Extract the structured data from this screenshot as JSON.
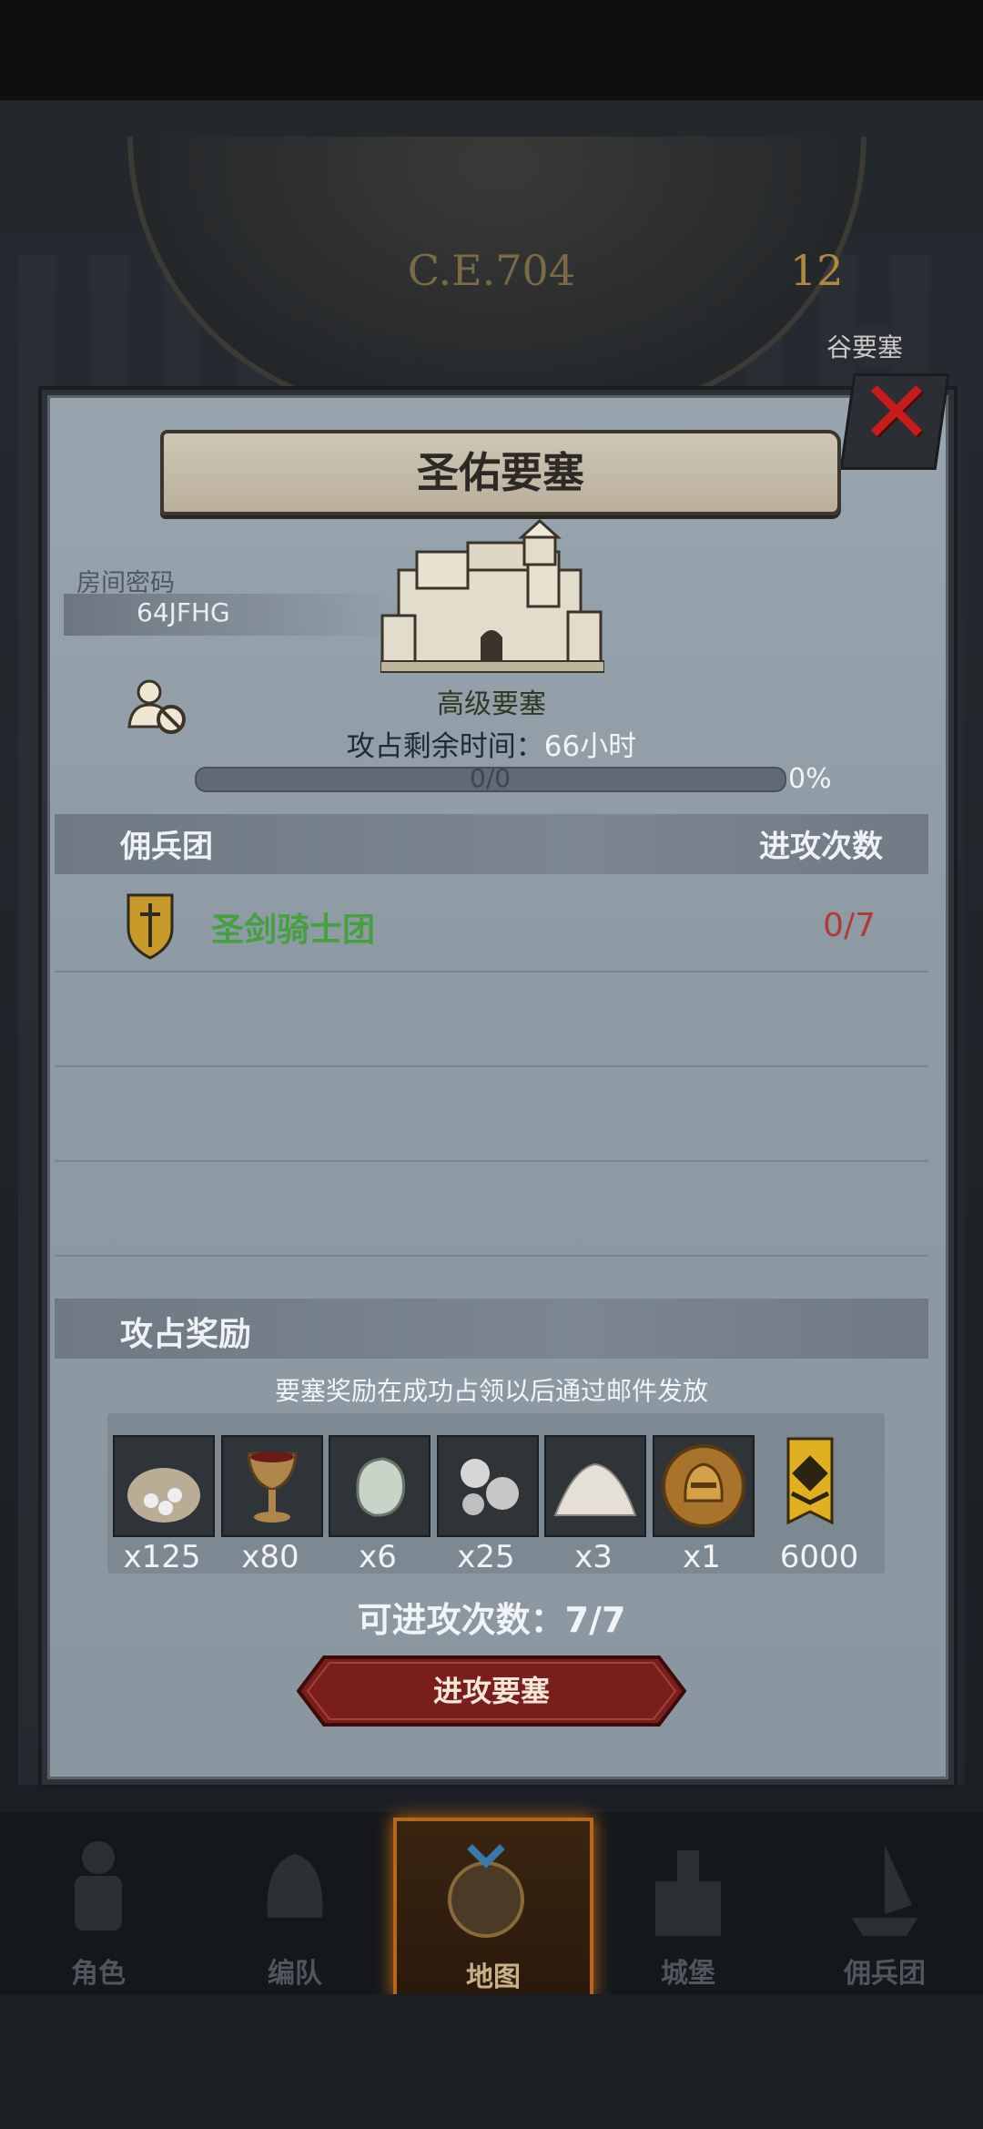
{
  "background": {
    "era": "C.E.704",
    "clock_numerals": [
      "12"
    ],
    "side_label": "谷要塞"
  },
  "dialog": {
    "title": "圣佑要塞",
    "close_icon": "close-x-icon",
    "room": {
      "label": "房间密码",
      "code": "64JFHG"
    },
    "fortress_level": "高级要塞",
    "time_label": "攻占剩余时间：",
    "time_value": "66小时",
    "progress": {
      "text": "0/0",
      "percent_text": "0%",
      "fraction": 0
    },
    "mercenary_header": {
      "left": "佣兵团",
      "right": "进攻次数"
    },
    "mercenaries": [
      {
        "name": "圣剑骑士团",
        "attacks": "0/7",
        "icon": "sword-shield-icon"
      }
    ],
    "rewards": {
      "title": "攻占奖励",
      "note": "要塞奖励在成功占领以后通过邮件发放",
      "items": [
        {
          "icon": "coin-sack-icon",
          "qty": "x125"
        },
        {
          "icon": "goblet-icon",
          "qty": "x80"
        },
        {
          "icon": "gem-stone-icon",
          "qty": "x6"
        },
        {
          "icon": "silver-pearls-icon",
          "qty": "x25"
        },
        {
          "icon": "powder-pile-icon",
          "qty": "x3"
        },
        {
          "icon": "knight-medal-icon",
          "qty": "x1"
        },
        {
          "icon": "rank-banner-icon",
          "qty": "6000"
        }
      ]
    },
    "attacks_left_label": "可进攻次数：",
    "attacks_left_value": "7/7",
    "attack_button": "进攻要塞"
  },
  "nav": [
    {
      "label": "角色",
      "icon": "knight-character-icon",
      "active": false
    },
    {
      "label": "编队",
      "icon": "helmet-formation-icon",
      "active": false
    },
    {
      "label": "地图",
      "icon": "world-map-icon",
      "active": true
    },
    {
      "label": "城堡",
      "icon": "castle-icon",
      "active": false
    },
    {
      "label": "佣兵团",
      "icon": "mercenary-ship-icon",
      "active": false
    }
  ],
  "colors": {
    "accent_green": "#46a040",
    "count_red": "#b23a3a",
    "close_red": "#c81c1c",
    "nav_active": "#b8661a"
  }
}
